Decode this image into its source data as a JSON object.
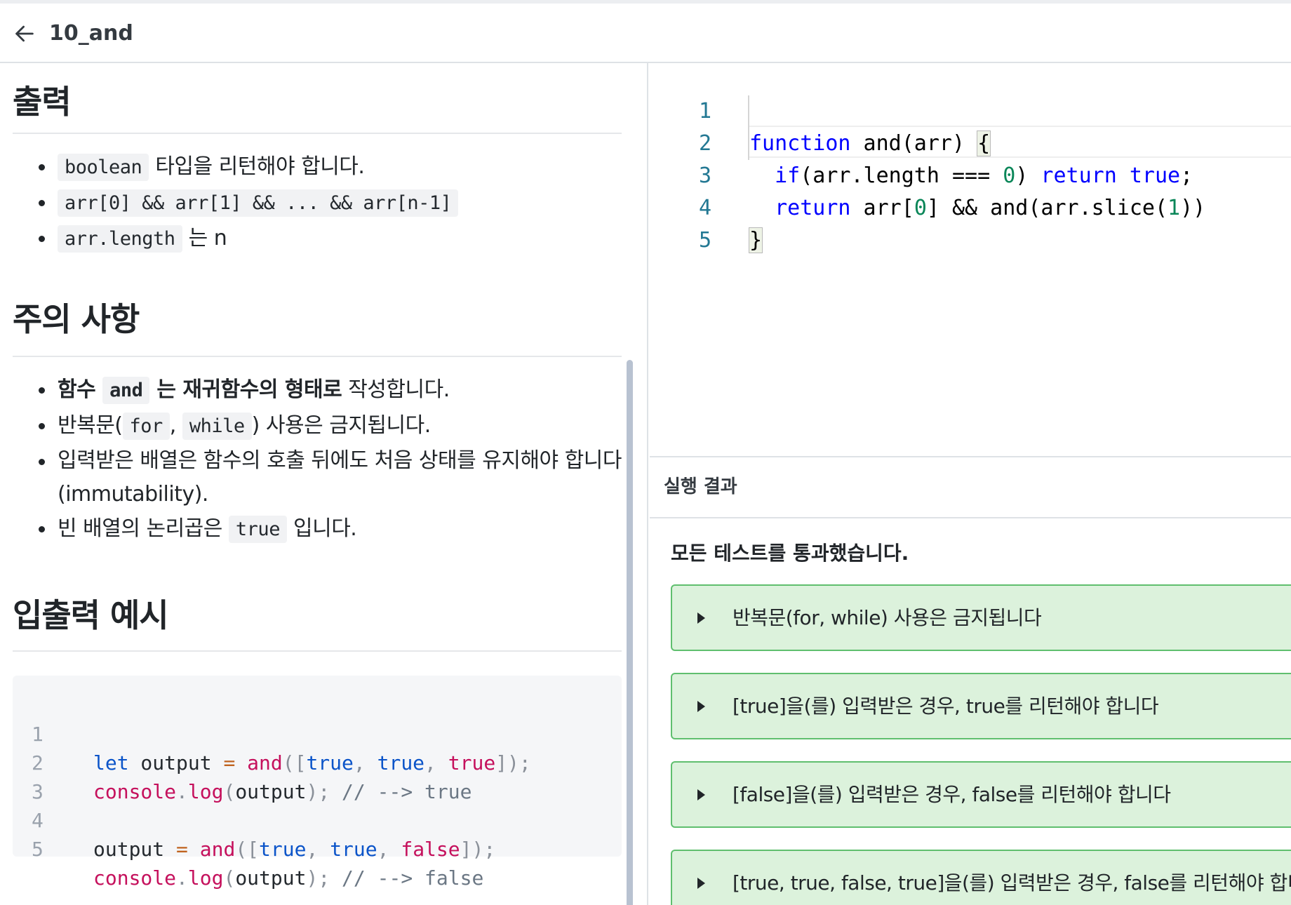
{
  "header": {
    "title": "10_and"
  },
  "sections": {
    "output": {
      "heading": "출력",
      "items": [
        {
          "code": "boolean",
          "text": " 타입을 리턴해야 합니다."
        },
        {
          "code": "arr[0] && arr[1] && ... && arr[n-1]",
          "text": ""
        },
        {
          "code": "arr.length",
          "text": " 는 n"
        }
      ]
    },
    "notes": {
      "heading": "주의 사항",
      "item1": {
        "pre": "함수 ",
        "code": "and",
        "bold": " 는 재귀함수의 형태로",
        "post": " 작성합니다."
      },
      "item2": {
        "pre": "반복문(",
        "code1": "for",
        "mid": ", ",
        "code2": "while",
        "post": ") 사용은 금지됩니다."
      },
      "item3": {
        "line1": "입력받은 배열은 함수의 호출 뒤에도 처음 상태를 유지해야 합니다",
        "line2": "(immutability)."
      },
      "item4": {
        "pre": "빈 배열의 논리곱은 ",
        "code": "true",
        "post": " 입니다."
      }
    },
    "examples": {
      "heading": "입출력 예시"
    }
  },
  "example_code": {
    "line_numbers": [
      "1",
      "2",
      "3",
      "4",
      "5"
    ],
    "l1": {
      "kw": "let",
      "v": " output ",
      "op": "=",
      "fn": " and",
      "p1": "([",
      "a": "true",
      "c1": ", ",
      "b": "true",
      "c2": ", ",
      "c": "true",
      "p2": "]);"
    },
    "l2": {
      "obj": "console",
      "dot": ".",
      "m": "log",
      "p1": "(",
      "arg": "output",
      "p2": ");",
      "cm": " // --> true"
    },
    "l4": {
      "v": "output ",
      "op": "=",
      "fn": " and",
      "p1": "([",
      "a": "true",
      "c1": ", ",
      "b": "true",
      "c2": ", ",
      "c": "false",
      "p2": "]);"
    },
    "l5": {
      "obj": "console",
      "dot": ".",
      "m": "log",
      "p1": "(",
      "arg": "output",
      "p2": ");",
      "cm": " // --> false"
    }
  },
  "editor": {
    "line_numbers": [
      "1",
      "2",
      "3",
      "4",
      "5"
    ],
    "l1": {
      "kw": "function",
      "rest": " and(arr) ",
      "brace": "{"
    },
    "l2": {
      "indent": "  ",
      "kw": "if",
      "a": "(arr.length === ",
      "num": "0",
      "b": ") ",
      "kw2": "return",
      "sp": " ",
      "kw3": "true",
      "semi": ";"
    },
    "l3": {
      "indent": "  ",
      "kw": "return",
      "a": " arr[",
      "num": "0",
      "b": "] && and(arr.slice(",
      "num2": "1",
      "c": "))"
    },
    "l4": {
      "brace": "}"
    }
  },
  "results": {
    "title": "실행 결과",
    "message": "모든 테스트를 통과했습니다.",
    "tests": [
      "반복문(for, while) 사용은 금지됩니다",
      "[true]을(를) 입력받은 경우, true를 리턴해야 합니다",
      "[false]을(를) 입력받은 경우, false를 리턴해야 합니다",
      "[true, true, false, true]을(를) 입력받은 경우, false를 리턴해야 합니다"
    ]
  },
  "colors": {
    "pass_bg": "#dcf2dc",
    "pass_border": "#5fbf6e",
    "keyword": "#0000ff",
    "number": "#098658"
  }
}
